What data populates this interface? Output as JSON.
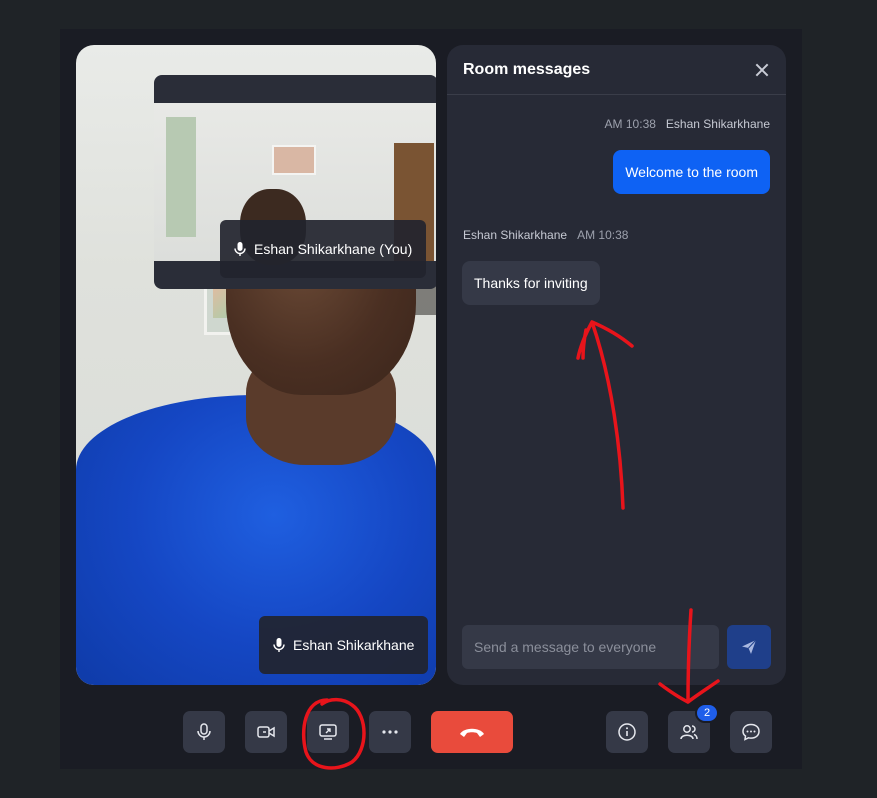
{
  "chat": {
    "title": "Room messages",
    "messages": [
      {
        "time": "AM 10:38",
        "sender": "Eshan Shikarkhane",
        "text": "Welcome to the room"
      },
      {
        "sender": "Eshan Shikarkhane",
        "time": "AM 10:38",
        "text": "Thanks for inviting"
      }
    ],
    "input_placeholder": "Send a message to everyone"
  },
  "video": {
    "main_participant": "Eshan Shikarkhane",
    "self_participant": "Eshan Shikarkhane (You)"
  },
  "toolbar": {
    "participants_count": "2",
    "buttons": [
      "mic-icon",
      "camera-icon",
      "screen-share-icon",
      "more-icon",
      "hang-up-icon",
      "info-icon",
      "participants-icon",
      "chat-icon"
    ]
  },
  "colors": {
    "accent": "#0e62f4",
    "hangup": "#e94b3c",
    "annotation": "#e8141b"
  }
}
